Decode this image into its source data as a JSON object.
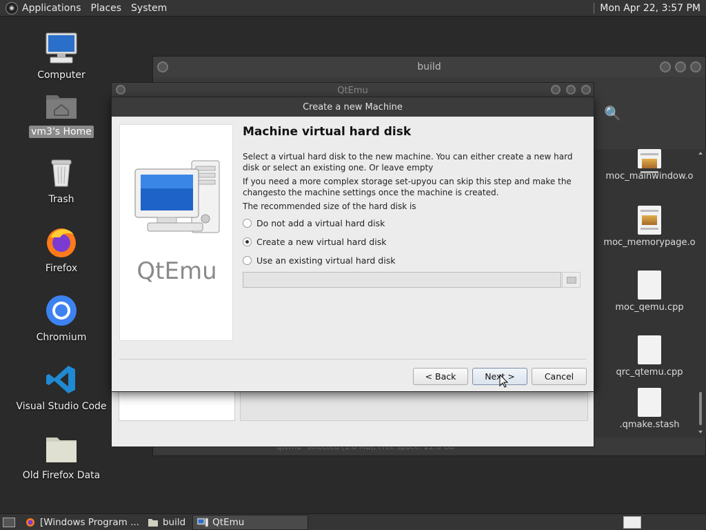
{
  "top_panel": {
    "menus": [
      "Applications",
      "Places",
      "System"
    ],
    "clock": "Mon Apr 22,  3:57 PM"
  },
  "desktop": {
    "icons": [
      {
        "label": "Computer"
      },
      {
        "label": "vm3's Home"
      },
      {
        "label": "Trash"
      },
      {
        "label": "Firefox"
      },
      {
        "label": "Chromium"
      },
      {
        "label": "Visual Studio Code"
      },
      {
        "label": "Old Firefox Data"
      }
    ]
  },
  "build_window": {
    "title": "build",
    "files": [
      "moc_mainwindow.o",
      "moc_memorypage.o",
      "moc_qemu.cpp",
      "qrc_qtemu.cpp",
      ".qmake.stash"
    ],
    "status": "\"qtemu\" selected (1.6 MB), Free space: 22.6 GB"
  },
  "qtemu_window": {
    "title": "QtEmu"
  },
  "dialog": {
    "title": "Create a new Machine",
    "brand": "QtEmu",
    "heading": "Machine virtual hard disk",
    "para1": "Select a virtual hard disk to the new machine. You can either create a new hard disk or select an existing one. Or leave empty",
    "para2": "If you need a more complex storage set-upyou can skip this step and make the changesto the machine settings once the machine is created.",
    "para3": "The recommended size of the hard disk is",
    "options": [
      {
        "label": "Do not add a virtual hard disk",
        "selected": false
      },
      {
        "label": "Create a new virtual hard disk",
        "selected": true
      },
      {
        "label": "Use an existing virtual hard disk",
        "selected": false
      }
    ],
    "path_value": "",
    "buttons": {
      "back": "< Back",
      "next": "Next >",
      "cancel": "Cancel"
    }
  },
  "taskbar": {
    "tasks": [
      "[Windows Program ...",
      "build",
      "QtEmu"
    ]
  }
}
